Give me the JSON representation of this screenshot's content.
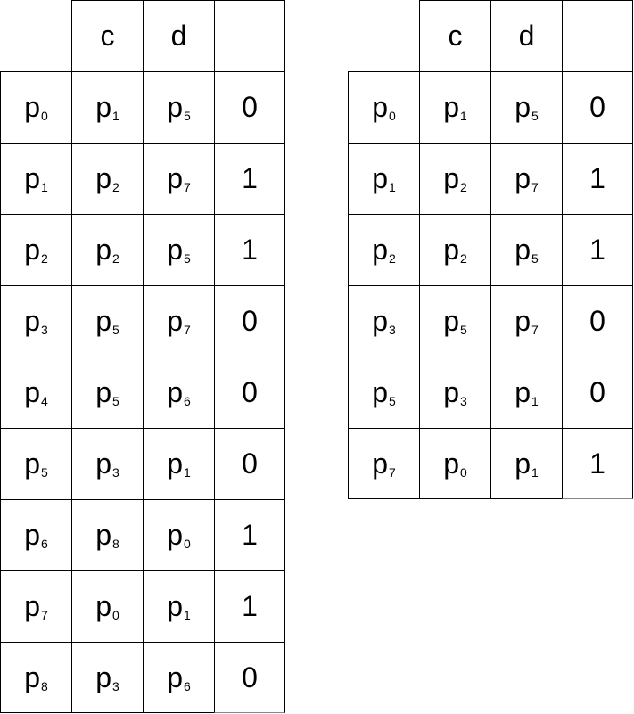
{
  "left_table": {
    "headers": [
      "",
      "c",
      "d",
      ""
    ],
    "rows": [
      {
        "state": [
          "p",
          "0"
        ],
        "c": [
          "p",
          "1"
        ],
        "d": [
          "p",
          "5"
        ],
        "flag": "0"
      },
      {
        "state": [
          "p",
          "1"
        ],
        "c": [
          "p",
          "2"
        ],
        "d": [
          "p",
          "7"
        ],
        "flag": "1"
      },
      {
        "state": [
          "p",
          "2"
        ],
        "c": [
          "p",
          "2"
        ],
        "d": [
          "p",
          "5"
        ],
        "flag": "1"
      },
      {
        "state": [
          "p",
          "3"
        ],
        "c": [
          "p",
          "5"
        ],
        "d": [
          "p",
          "7"
        ],
        "flag": "0"
      },
      {
        "state": [
          "p",
          "4"
        ],
        "c": [
          "p",
          "5"
        ],
        "d": [
          "p",
          "6"
        ],
        "flag": "0"
      },
      {
        "state": [
          "p",
          "5"
        ],
        "c": [
          "p",
          "3"
        ],
        "d": [
          "p",
          "1"
        ],
        "flag": "0"
      },
      {
        "state": [
          "p",
          "6"
        ],
        "c": [
          "p",
          "8"
        ],
        "d": [
          "p",
          "0"
        ],
        "flag": "1"
      },
      {
        "state": [
          "p",
          "7"
        ],
        "c": [
          "p",
          "0"
        ],
        "d": [
          "p",
          "1"
        ],
        "flag": "1"
      },
      {
        "state": [
          "p",
          "8"
        ],
        "c": [
          "p",
          "3"
        ],
        "d": [
          "p",
          "6"
        ],
        "flag": "0"
      }
    ]
  },
  "right_table": {
    "headers": [
      "",
      "c",
      "d",
      ""
    ],
    "rows": [
      {
        "state": [
          "p",
          "0"
        ],
        "c": [
          "p",
          "1"
        ],
        "d": [
          "p",
          "5"
        ],
        "flag": "0"
      },
      {
        "state": [
          "p",
          "1"
        ],
        "c": [
          "p",
          "2"
        ],
        "d": [
          "p",
          "7"
        ],
        "flag": "1"
      },
      {
        "state": [
          "p",
          "2"
        ],
        "c": [
          "p",
          "2"
        ],
        "d": [
          "p",
          "5"
        ],
        "flag": "1"
      },
      {
        "state": [
          "p",
          "3"
        ],
        "c": [
          "p",
          "5"
        ],
        "d": [
          "p",
          "7"
        ],
        "flag": "0"
      },
      {
        "state": [
          "p",
          "5"
        ],
        "c": [
          "p",
          "3"
        ],
        "d": [
          "p",
          "1"
        ],
        "flag": "0"
      },
      {
        "state": [
          "p",
          "7"
        ],
        "c": [
          "p",
          "0"
        ],
        "d": [
          "p",
          "1"
        ],
        "flag": "1"
      }
    ]
  }
}
